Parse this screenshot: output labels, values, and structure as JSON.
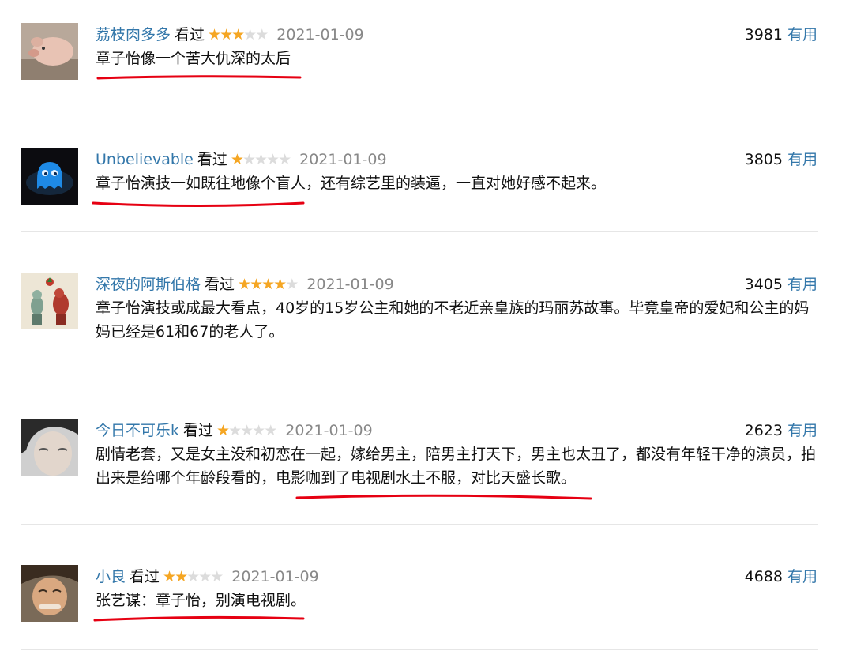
{
  "reviews": [
    {
      "user": "荔枝肉多多",
      "watched_label": "看过",
      "rating": 3,
      "date": "2021-01-09",
      "votes": "3981",
      "useful_label": "有用",
      "avatar": "pig-photo",
      "content": "章子怡像一个苦大仇深的太后"
    },
    {
      "user": "Unbelievable",
      "watched_label": "看过",
      "rating": 1,
      "date": "2021-01-09",
      "votes": "3805",
      "useful_label": "有用",
      "avatar": "blue-ghost-figure",
      "content": "章子怡演技一如既往地像个盲人，还有综艺里的装逼，一直对她好感不起来。"
    },
    {
      "user": "深夜的阿斯伯格",
      "watched_label": "看过",
      "rating": 4,
      "date": "2021-01-09",
      "votes": "3405",
      "useful_label": "有用",
      "avatar": "illustrated-creatures",
      "content": "章子怡演技或成最大看点，40岁的15岁公主和她的不老近亲皇族的玛丽苏故事。毕竟皇帝的爱妃和公主的妈妈已经是61和67的老人了。"
    },
    {
      "user": "今日不可乐k",
      "watched_label": "看过",
      "rating": 1,
      "date": "2021-01-09",
      "votes": "2623",
      "useful_label": "有用",
      "avatar": "portrait-photo",
      "content": "剧情老套，又是女主没和初恋在一起，嫁给男主，陪男主打天下，男主也太丑了，都没有年轻干净的演员，拍出来是给哪个年龄段看的，电影咖到了电视剧水土不服，对比天盛长歌。"
    },
    {
      "user": "小良",
      "watched_label": "看过",
      "rating": 2,
      "date": "2021-01-09",
      "votes": "4688",
      "useful_label": "有用",
      "avatar": "portrait-photo",
      "content": "张艺谋：章子怡，别演电视剧。"
    }
  ],
  "colors": {
    "link": "#3377aa",
    "star_on": "#f5a623",
    "star_off": "#dcdcdc",
    "annotation": "#e60012"
  }
}
